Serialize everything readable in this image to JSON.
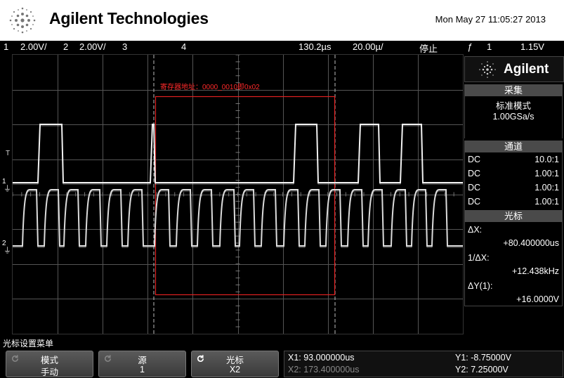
{
  "header": {
    "brand": "Agilent Technologies",
    "datetime": "Mon May 27 11:05:27 2013"
  },
  "status": {
    "ch1_num": "1",
    "ch1_scale": "2.00V/",
    "ch2_num": "2",
    "ch2_scale": "2.00V/",
    "ch3_num": "3",
    "ch4_num": "4",
    "delay": "130.2&#x03BC;s",
    "delay_text": "130.2µs",
    "timebase": "20.00µ/",
    "run_state": "停止",
    "trigger_slope": "ƒ",
    "trigger_source": "1",
    "trigger_level": "1.15V"
  },
  "screen": {
    "register_label": "寄存器地址：0000_0010即0x02",
    "markers": {
      "trigger": "T",
      "ch1": "1",
      "ch2": "2"
    }
  },
  "side_panel": {
    "logo_text": "Agilent",
    "acquire": {
      "title": "采集",
      "mode": "标准模式",
      "rate": "1.00GSa/s"
    },
    "channels": {
      "title": "通道",
      "rows": [
        {
          "coupling": "DC",
          "ratio": "10.0:1"
        },
        {
          "coupling": "DC",
          "ratio": "1.00:1"
        },
        {
          "coupling": "DC",
          "ratio": "1.00:1"
        },
        {
          "coupling": "DC",
          "ratio": "1.00:1"
        }
      ]
    },
    "cursors": {
      "title": "光标",
      "dx_label": "ΔX:",
      "dx_value": "+80.400000us",
      "inv_dx_label": "1/ΔX:",
      "inv_dx_value": "+12.438kHz",
      "dy_label": "ΔY(1):",
      "dy_value": "+16.0000V"
    }
  },
  "softkeys": {
    "menu_title": "光标设置菜单",
    "mode": {
      "label": "模式",
      "value": "手动"
    },
    "source": {
      "label": "源",
      "value": "1"
    },
    "cursor": {
      "label": "光标",
      "value": "X2"
    }
  },
  "readout": {
    "x1": "X1: 93.000000us",
    "x2": "X2: 173.400000us",
    "y1": "Y1: -8.75000V",
    "y2": "Y2: 7.25000V"
  },
  "colors": {
    "ch1_trace": "#f2f2f2",
    "ch2_trace": "#dcdcdc",
    "register_box": "#e02020",
    "grid": "#555555"
  }
}
